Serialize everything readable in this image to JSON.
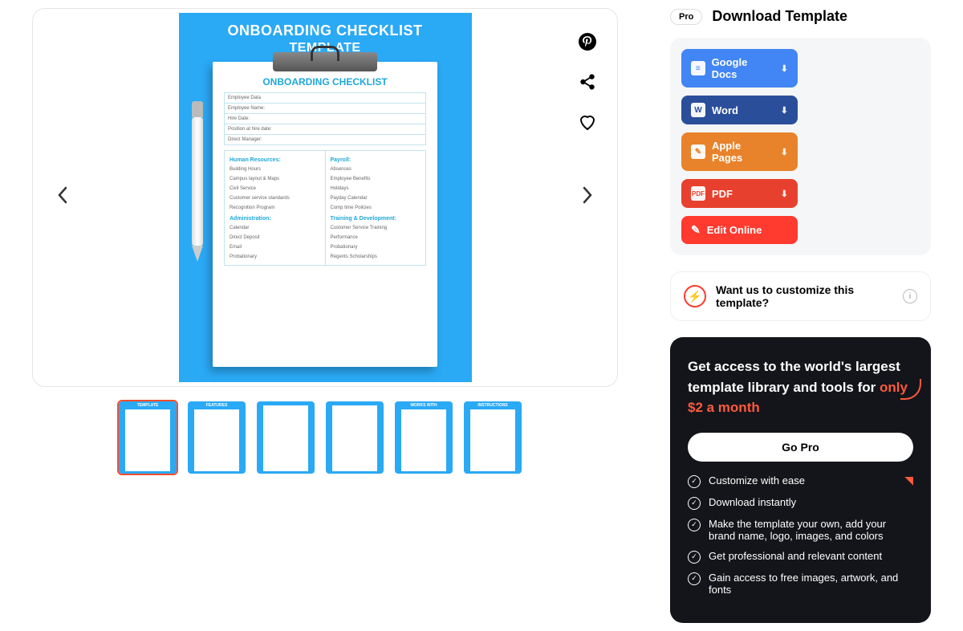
{
  "header": {
    "pro_badge": "Pro",
    "title": "Download Template"
  },
  "buttons": {
    "google_docs": "Google Docs",
    "word": "Word",
    "apple_pages": "Apple Pages",
    "pdf": "PDF",
    "edit_online": "Edit Online"
  },
  "customize": {
    "text": "Want us to customize this template?"
  },
  "pro": {
    "heading_a": "Get access to the world's largest template library and tools for ",
    "price": "only $2 a month",
    "go_pro": "Go Pro",
    "features": [
      "Customize with ease",
      "Download instantly",
      "Make the template your own, add your brand name, logo, images, and colors",
      "Get professional and relevant content",
      "Gain access to free images, artwork, and fonts"
    ]
  },
  "preview": {
    "title1": "ONBOARDING CHECKLIST",
    "title2": "TEMPLATE",
    "doc_title": "ONBOARDING CHECKLIST",
    "employee_rows": [
      "Employee Data",
      "Employee Name:",
      "Hire Date:",
      "Position at hire date:",
      "Direct Manager:"
    ],
    "left_sections": [
      {
        "h": "Human Resources:",
        "items": [
          "Building Hours",
          "Campus layout & Maps",
          "Civil Service",
          "Customer service standards",
          "Recognition Program"
        ]
      },
      {
        "h": "Administration:",
        "items": [
          "Calendar",
          "Direct Deposit",
          "Email",
          "Probationary"
        ]
      }
    ],
    "right_sections": [
      {
        "h": "Payroll:",
        "items": [
          "Absences",
          "Employee Benefits",
          "Holidays",
          "Payday Calendar",
          "Comp time Policies"
        ]
      },
      {
        "h": "Training & Development:",
        "items": [
          "Customer Service Training",
          "Performance",
          "Probationary",
          "Regents Scholarships"
        ]
      }
    ]
  },
  "thumbs": [
    "TEMPLATE",
    "FEATURES",
    "",
    "",
    "WORKS WITH",
    "INSTRUCTIONS"
  ]
}
